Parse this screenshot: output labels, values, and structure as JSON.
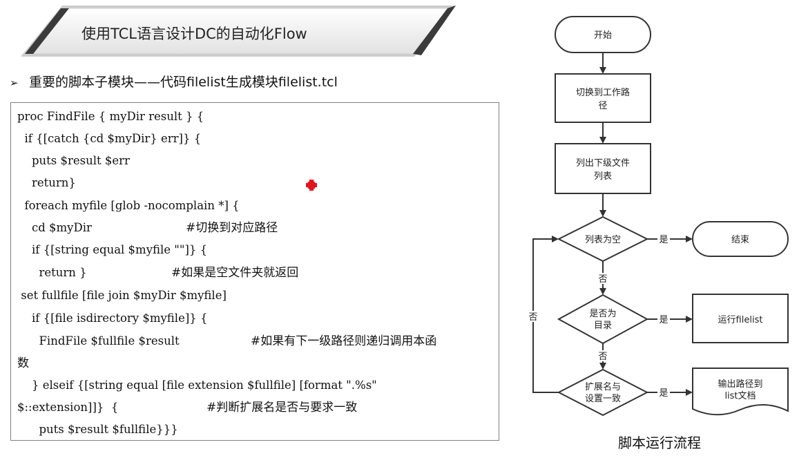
{
  "banner": {
    "title": "使用TCL语言设计DC的自动化Flow"
  },
  "subtitle": {
    "bullet": "➢",
    "text": "重要的脚本子模块——代码filelist生成模块filelist.tcl"
  },
  "code": {
    "lines": [
      "proc FindFile { myDir result } {",
      "  if {[catch {cd $myDir} err]} {",
      "    puts $result $err",
      "    return}",
      "  foreach myfile [glob -nocomplain *] {",
      "    cd $myDir",
      "    if {[string equal $myfile \"\"]} {",
      "      return }",
      " set fullfile [file join $myDir $myfile]",
      "    if {[file isdirectory $myfile]} {",
      "      FindFile $fullfile $result",
      "数",
      "    } elseif {[string equal [file extension $fullfile] [format \".%s\"",
      "$::extension]]}  {",
      "      puts $result $fullfile}}}"
    ],
    "comments": [
      "#切换到对应路径",
      "#如果是空文件夹就返回",
      "#如果有下一级路径则递归调用本函",
      "#判断扩展名是否与要求一致"
    ]
  },
  "flowchart": {
    "start": "开始",
    "step1": [
      "切换到工作路",
      "径"
    ],
    "step2": [
      "列出下级文件",
      "列表"
    ],
    "decision1": "列表为空",
    "end": "结束",
    "decision2": [
      "是否为",
      "目录"
    ],
    "run": "运行filelist",
    "decision3": [
      "扩展名与",
      "设置一致"
    ],
    "output": [
      "输出路径到",
      "list文档"
    ],
    "yes": "是",
    "no": "否"
  },
  "caption": "脚本运行流程",
  "colors": {
    "marker": "#e8121a",
    "banner_light": "#f2f2f2",
    "banner_dark": "#3b3b3b"
  }
}
